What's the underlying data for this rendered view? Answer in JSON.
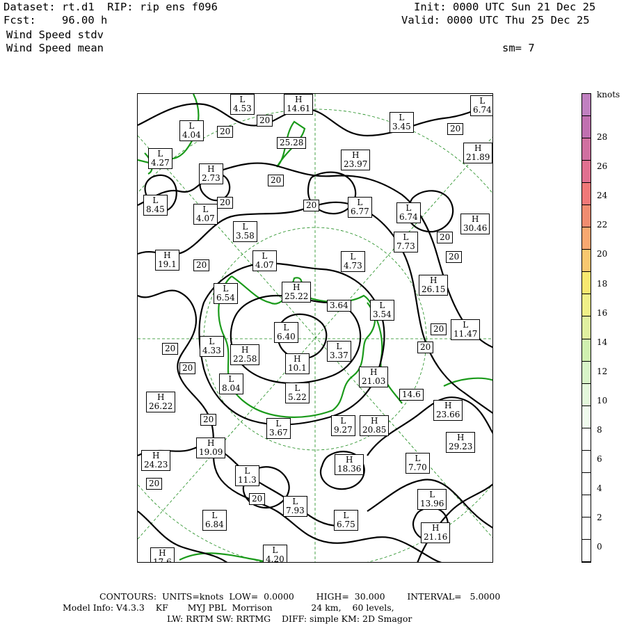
{
  "header": {
    "dataset_line": "Dataset: rt.d1  RIP: rip ens f096",
    "fcst_line": "Fcst:    96.00 h",
    "field1": "Wind Speed stdv",
    "field2": "Wind Speed mean",
    "init_line": "Init: 0000 UTC Sun 21 Dec 25",
    "valid_line": "Valid: 0000 UTC Thu 25 Dec 25",
    "sm_line": "sm= 7"
  },
  "legend": {
    "units": "knots",
    "ticks": [
      "28",
      "26",
      "24",
      "22",
      "20",
      "18",
      "16",
      "14",
      "12",
      "10",
      "8",
      "6",
      "4",
      "2",
      "0"
    ],
    "colors": [
      "#c080c0",
      "#c070b0",
      "#d070a0",
      "#e07090",
      "#f07878",
      "#f08c70",
      "#f8a870",
      "#f8c870",
      "#f8e870",
      "#f0f088",
      "#e0f0a0",
      "#d0f0b0",
      "#d8f4c8",
      "#e4f8dc",
      "#f0fbee",
      "#ffffff",
      "#ffffff",
      "#ffffff",
      "#ffffff",
      "#ffffff",
      "#ffffff"
    ]
  },
  "map_labels": [
    {
      "t": "L",
      "v": "4.53"
    },
    {
      "t": "H",
      "v": "14.61"
    },
    {
      "t": "L",
      "v": "6.74"
    },
    {
      "t": "L",
      "v": "4.04"
    },
    {
      "t": "",
      "v": "20"
    },
    {
      "t": "",
      "v": "20"
    },
    {
      "t": "L",
      "v": "3.45"
    },
    {
      "t": "",
      "v": "20"
    },
    {
      "t": "L",
      "v": "4.27"
    },
    {
      "t": "",
      "v": "25.28"
    },
    {
      "t": "H",
      "v": "21.89"
    },
    {
      "t": "H",
      "v": "23.97"
    },
    {
      "t": "H",
      "v": "2.73"
    },
    {
      "t": "",
      "v": "20"
    },
    {
      "t": "L",
      "v": "8.45"
    },
    {
      "t": "L",
      "v": "4.07"
    },
    {
      "t": "",
      "v": "20"
    },
    {
      "t": "",
      "v": "20"
    },
    {
      "t": "L",
      "v": "6.77"
    },
    {
      "t": "L",
      "v": "6.74"
    },
    {
      "t": "H",
      "v": "30.46"
    },
    {
      "t": "L",
      "v": "3.58"
    },
    {
      "t": "L",
      "v": "7.73"
    },
    {
      "t": "",
      "v": "20"
    },
    {
      "t": "",
      "v": "20"
    },
    {
      "t": "H",
      "v": "19.1"
    },
    {
      "t": "L",
      "v": "4.07"
    },
    {
      "t": "L",
      "v": "4.73"
    },
    {
      "t": "",
      "v": "20"
    },
    {
      "t": "H",
      "v": "26.15"
    },
    {
      "t": "L",
      "v": "6.54"
    },
    {
      "t": "H",
      "v": "25.22"
    },
    {
      "t": "",
      "v": "3.64"
    },
    {
      "t": "L",
      "v": "3.54"
    },
    {
      "t": "L",
      "v": "6.40"
    },
    {
      "t": "",
      "v": "20"
    },
    {
      "t": "L",
      "v": "11.47"
    },
    {
      "t": "L",
      "v": "4.33"
    },
    {
      "t": "",
      "v": "20"
    },
    {
      "t": "H",
      "v": "22.58"
    },
    {
      "t": "L",
      "v": "3.37"
    },
    {
      "t": "",
      "v": "20"
    },
    {
      "t": "H",
      "v": "10.1"
    },
    {
      "t": "",
      "v": "20"
    },
    {
      "t": "H",
      "v": "21.03"
    },
    {
      "t": "L",
      "v": "8.04"
    },
    {
      "t": "H",
      "v": "26.22"
    },
    {
      "t": "L",
      "v": "5.22"
    },
    {
      "t": "",
      "v": "14.6"
    },
    {
      "t": "H",
      "v": "23.66"
    },
    {
      "t": "",
      "v": "20"
    },
    {
      "t": "L",
      "v": "3.67"
    },
    {
      "t": "L",
      "v": "9.27"
    },
    {
      "t": "H",
      "v": "20.85"
    },
    {
      "t": "H",
      "v": "19.09"
    },
    {
      "t": "H",
      "v": "29.23"
    },
    {
      "t": "H",
      "v": "24.23"
    },
    {
      "t": "L",
      "v": "7.70"
    },
    {
      "t": "H",
      "v": "18.36"
    },
    {
      "t": "L",
      "v": "11.3"
    },
    {
      "t": "",
      "v": "20"
    },
    {
      "t": "",
      "v": "20"
    },
    {
      "t": "L",
      "v": "13.96"
    },
    {
      "t": "L",
      "v": "7.93"
    },
    {
      "t": "L",
      "v": "6.84"
    },
    {
      "t": "L",
      "v": "6.75"
    },
    {
      "t": "H",
      "v": "21.16"
    },
    {
      "t": "H",
      "v": "17.6"
    },
    {
      "t": "L",
      "v": "4.20"
    }
  ],
  "footer": {
    "line1": "CONTOURS:  UNITS=knots  LOW=  0.0000        HIGH=  30.000        INTERVAL=   5.0000",
    "line2": "Model Info: V4.3.3    KF       MYJ PBL  Morrison              24 km,    60 levels,",
    "line3": "LW: RRTM SW: RRTMG    DIFF: simple KM: 2D Smagor"
  }
}
